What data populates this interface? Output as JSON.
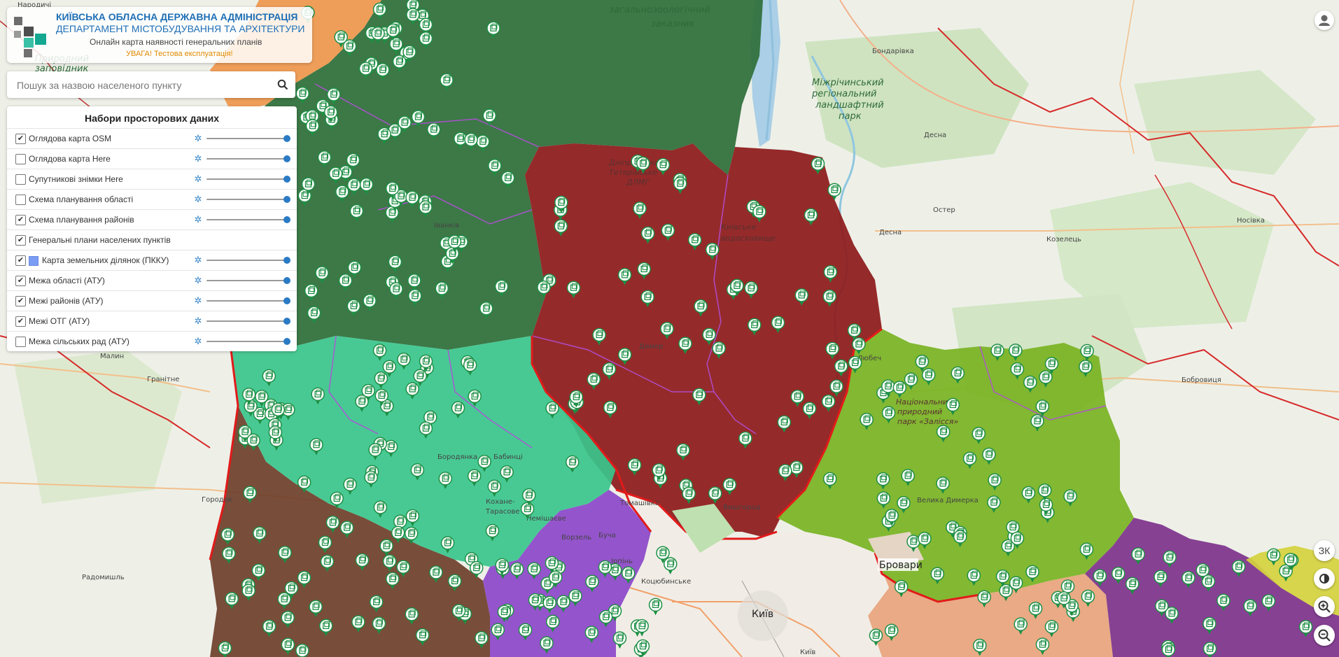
{
  "header": {
    "title_line1": "КИЇВСЬКА ОБЛАСНА ДЕРЖАВНА АДМІНІСТРАЦІЯ",
    "title_line2": "ДЕПАРТАМЕНТ МІСТОБУДУВАННЯ ТА АРХІТЕКТУРИ",
    "subtitle": "Онлайн карта наявності генеральних планів",
    "warning": "УВАГА! Тестова експлуатація!"
  },
  "search": {
    "placeholder": "Пошук за назвою населеного пункту"
  },
  "layers": {
    "title": "Набори просторових даних",
    "items": [
      {
        "label": "Оглядова карта OSM",
        "checked": true,
        "mark": "✔",
        "slider": 1.0
      },
      {
        "label": "Оглядова карта Here",
        "checked": false,
        "mark": "",
        "slider": 1.0
      },
      {
        "label": "Супутникові знімки Here",
        "checked": false,
        "mark": "",
        "slider": 1.0
      },
      {
        "label": "Схема планування області",
        "checked": false,
        "mark": "",
        "slider": 1.0
      },
      {
        "label": "Схема планування районів",
        "checked": true,
        "mark": "✔",
        "slider": 1.0
      },
      {
        "label": "Генеральні плани населених пунктів",
        "checked": true,
        "mark": "✔",
        "slider": null
      },
      {
        "label": "Карта земельних ділянок (ПККУ)",
        "checked": true,
        "mark": "✔",
        "slider": 1.0
      },
      {
        "label": "Межа області (АТУ)",
        "checked": true,
        "mark": "✔",
        "slider": 1.0
      },
      {
        "label": "Межі районів (АТУ)",
        "checked": true,
        "mark": "✔",
        "slider": 1.0
      },
      {
        "label": "Межі ОТГ (АТУ)",
        "checked": true,
        "mark": "✔",
        "slider": 1.0
      },
      {
        "label": "Межа сільських рад (АТУ)",
        "checked": false,
        "mark": "",
        "slider": 1.0
      }
    ]
  },
  "controls": {
    "basemap_label": "ЗК"
  },
  "map": {
    "places": {
      "kyiv": "Київ",
      "brovary": "Бровари",
      "oster": "Остер",
      "desna": "Десна",
      "kozelets": "Козелець",
      "nosivka": "Носівка",
      "malyn": "Малин",
      "granitne": "Гранітне",
      "gorodok": "Городок",
      "radomyshl": "Радомишль",
      "bobrovytsia": "Бобровиця",
      "bucha": "Буча",
      "vyshhorod": "Вишгород",
      "kotsiubynske": "Коцюбинське",
      "irpin": "Ірпінь",
      "vorzel": "Ворзель",
      "dymer": "Димер",
      "ivankiv": "Іванків",
      "liubych": "Любеч",
      "borodianka": "Бородянка",
      "velyka_dymerka": "Велика Димерка",
      "zabuyannia": "Забуяння",
      "irpin_reserve": "Природний заповідник",
      "zoo_reserve": "загальнозоологічний заказник",
      "mizhrichynskyi": "Міжрічинський регіональний ландшафтний парк",
      "dnipro_dlmg": "Дніпровсько-Тетерівське ДЛМГ",
      "kyiv_sea": "Київське водосховище",
      "zalissia": "Національний природний парк «Залісся»",
      "bondarivka": "Бондарівка",
      "kokhanivka": "Кохане-Тарасове",
      "nemishaieve": "Немішаєве",
      "tomashi": "Томашівка",
      "kyiv_river": "Київ"
    }
  },
  "colors": {
    "district_darkgreen": "#2f6f3a",
    "district_darkred": "#8e1b1b",
    "district_lightgreen": "#3ac58c",
    "district_brown": "#6e3f2a",
    "district_purple": "#8a43c9",
    "district_olive": "#7ab423",
    "district_orange": "#ee8f3f",
    "district_violet": "#7a2d8a",
    "district_peach": "#e8a27a",
    "district_yellow": "#d5d33d",
    "border_red": "#e21a1a",
    "marker_green": "#1e8f44",
    "accent_blue": "#1f6fb5"
  }
}
